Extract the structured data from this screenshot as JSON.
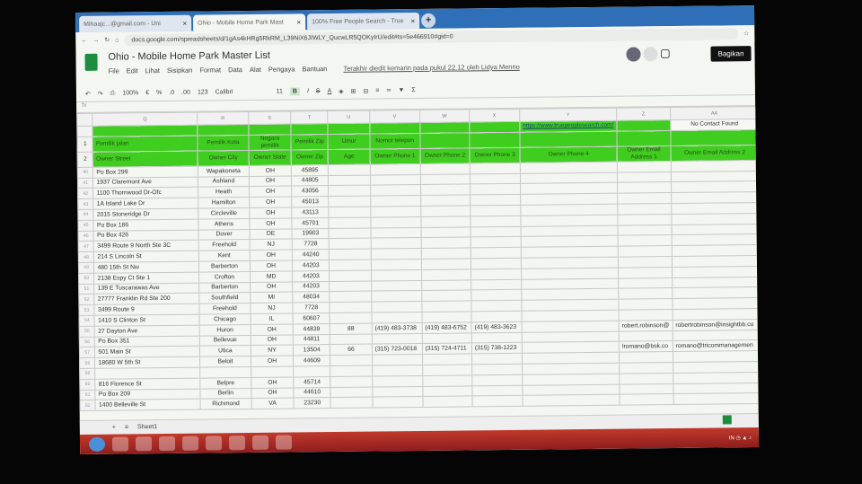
{
  "browser": {
    "tabs": [
      {
        "label": "Mihaajc...@gmail.com - Uni"
      },
      {
        "label": "Ohio - Mobile Home Park Mast",
        "active": true
      },
      {
        "label": "100% Free People Search - True"
      }
    ],
    "url": "docs.google.com/spreadsheets/d/1gAs4kHRg5RkRM_L39NiX6JIWLY_QucwLR5QOKyIrU/edit#ts=5e466910#gid=0"
  },
  "doc": {
    "title": "Ohio - Mobile Home Park Master List",
    "menu": [
      "File",
      "Edit",
      "Lihat",
      "Sisipkan",
      "Format",
      "Data",
      "Alat",
      "Pengaya",
      "Bantuan"
    ],
    "last_edit": "Terakhir diedit kemarin pada pukul 22.12 oleh Lidya Menno",
    "share_label": "Bagikan",
    "toolbar": {
      "zoom": "100%",
      "currency": "€",
      "percent": "%",
      "dec_less": ".0",
      "dec_more": ".00",
      "format": "123",
      "font": "Calibri",
      "size": "11",
      "bold": "B",
      "italic": "I",
      "strike": "S",
      "color": "A"
    }
  },
  "sheet": {
    "columns": [
      "Q",
      "R",
      "S",
      "T",
      "U",
      "V",
      "W",
      "X",
      "Y",
      "Z",
      "AA"
    ],
    "header_top": [
      "",
      "",
      "",
      "",
      "",
      "",
      "",
      "",
      "https://www.truepeoplesearch.com/",
      "",
      "No Contact Found"
    ],
    "header1": [
      "Pemilik jalan",
      "Pemilik Kota",
      "Negara pemilik",
      "Pemilik Zip",
      "Umur",
      "Nomor telepon",
      "",
      "",
      "",
      "",
      ""
    ],
    "header2": [
      "Owner Street",
      "Owner City",
      "Owner State",
      "Owner Zip",
      "Age",
      "Owner Phone 1",
      "Owner Phone 2",
      "Owner Phone 3",
      "Owner Phone 4",
      "Owner Email Address 1",
      "Owner Email Address 2"
    ],
    "rows": [
      {
        "n": "40",
        "street": "Po Box 299",
        "city": "Wapakoneta",
        "state": "OH",
        "zip": "45895"
      },
      {
        "n": "41",
        "street": "1937 Claremont Ave",
        "city": "Ashland",
        "state": "OH",
        "zip": "44805"
      },
      {
        "n": "42",
        "street": "1100 Thornwood Dr-Ofc",
        "city": "Heath",
        "state": "OH",
        "zip": "43056"
      },
      {
        "n": "43",
        "street": "1A Island Lake Dr",
        "city": "Hamilton",
        "state": "OH",
        "zip": "45013"
      },
      {
        "n": "44",
        "street": "2015 Stoneridge Dr",
        "city": "Circleville",
        "state": "OH",
        "zip": "43113"
      },
      {
        "n": "45",
        "street": "Po Box 186",
        "city": "Athens",
        "state": "OH",
        "zip": "45701"
      },
      {
        "n": "46",
        "street": "Po Box 426",
        "city": "Dover",
        "state": "DE",
        "zip": "19903"
      },
      {
        "n": "47",
        "street": "3499 Route 9 North Ste 3C",
        "city": "Freehold",
        "state": "NJ",
        "zip": "7728"
      },
      {
        "n": "48",
        "street": "214 S Lincoln St",
        "city": "Kent",
        "state": "OH",
        "zip": "44240"
      },
      {
        "n": "49",
        "street": "480 15th St Nw",
        "city": "Barberton",
        "state": "OH",
        "zip": "44203"
      },
      {
        "n": "50",
        "street": "2138 Espy Ct Ste 1",
        "city": "Crofton",
        "state": "MD",
        "zip": "44203"
      },
      {
        "n": "51",
        "street": "139 E Tuscarawas Ave",
        "city": "Barberton",
        "state": "OH",
        "zip": "44203"
      },
      {
        "n": "52",
        "street": "27777 Franklin Rd Ste 200",
        "city": "Southfield",
        "state": "MI",
        "zip": "48034"
      },
      {
        "n": "53",
        "street": "3499 Route 9",
        "city": "Freehold",
        "state": "NJ",
        "zip": "7728"
      },
      {
        "n": "54",
        "street": "1410 S Clinton St",
        "city": "Chicago",
        "state": "IL",
        "zip": "60607"
      },
      {
        "n": "55",
        "street": "27 Dayton Ave",
        "city": "Huron",
        "state": "OH",
        "zip": "44839",
        "age": "88",
        "p1": "(419) 483-3738",
        "p2": "(419) 483-6752",
        "p3": "(419) 483-3623",
        "e1": "robert.robinson@",
        "e2": "robertrobinson@insightbb.co"
      },
      {
        "n": "56",
        "street": "Po Box 351",
        "city": "Bellevue",
        "state": "OH",
        "zip": "44811"
      },
      {
        "n": "57",
        "street": "501 Main St",
        "city": "Utica",
        "state": "NY",
        "zip": "13504",
        "age": "66",
        "p1": "(315) 723-0018",
        "p2": "(315) 724-4711",
        "p3": "(315) 738-1223",
        "e1": "lromano@bsk.co",
        "e2": "romano@tricommanagemen"
      },
      {
        "n": "58",
        "street": "18680 W 5th St",
        "city": "Beloit",
        "state": "OH",
        "zip": "44609"
      },
      {
        "n": "59"
      },
      {
        "n": "60",
        "street": "816 Florence St",
        "city": "Belpre",
        "state": "OH",
        "zip": "45714"
      },
      {
        "n": "61",
        "street": "Po Box 209",
        "city": "Berlin",
        "state": "OH",
        "zip": "44610"
      },
      {
        "n": "62",
        "street": "1400 Belleville St",
        "city": "Richmond",
        "state": "VA",
        "zip": "23230"
      }
    ],
    "sheet_tab": "Sheet1"
  },
  "colors": {
    "header_green": "#3fcd1f",
    "taskbar": "#b03028",
    "tabbar": "#2f6fb8"
  }
}
